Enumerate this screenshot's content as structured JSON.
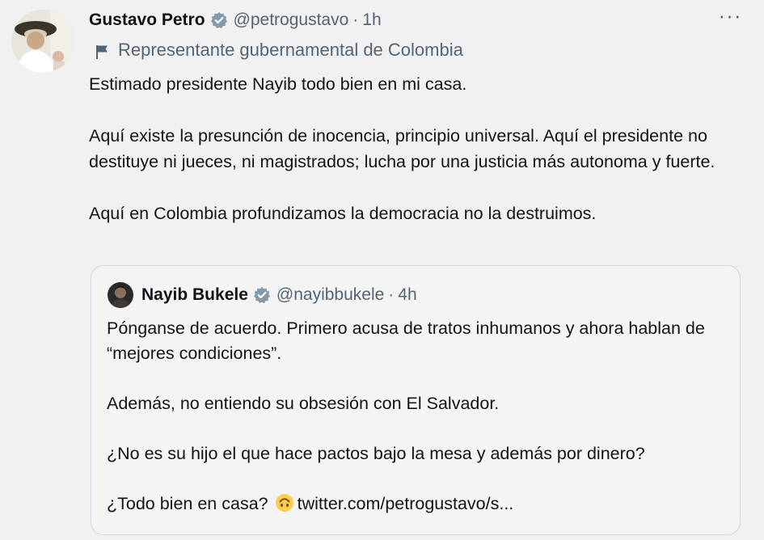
{
  "tweet": {
    "author_name": "Gustavo Petro",
    "handle": "@petrogustavo",
    "separator": "·",
    "time": "1h",
    "more_label": "···",
    "label": "Representante gubernamental de Colombia",
    "paragraphs": [
      "Estimado presidente Nayib todo bien en mi casa.",
      "Aquí existe la presunción de inocencia, principio universal. Aquí el presidente no destituye ni jueces, ni magistrados; lucha por una justicia más autonoma y fuerte.",
      "Aquí en Colombia profundizamos la democracia no la destruimos."
    ]
  },
  "quote": {
    "author_name": "Nayib Bukele",
    "handle": "@nayibbukele",
    "separator": "·",
    "time": "4h",
    "paragraphs": [
      "Pónganse de acuerdo. Primero acusa de tratos inhumanos y ahora hablan de “mejores condiciones”.",
      "Además, no entiendo su obsesión con El Salvador.",
      "¿No es su hijo el que hace pactos bajo la mesa y además por dinero?"
    ],
    "last_line_prefix": "¿Todo bien en casa?",
    "link": "twitter.com/petrogustavo/s..."
  },
  "icons": {
    "verified": "verified-badge-icon",
    "flag": "government-flag-icon",
    "emoji": "upside-down-face-emoji",
    "more": "more-options-icon"
  },
  "colors": {
    "verified_gray": "#829aab",
    "secondary_text": "#536471",
    "primary_text": "#0f1419",
    "emoji_yellow": "#ffcc4d"
  }
}
